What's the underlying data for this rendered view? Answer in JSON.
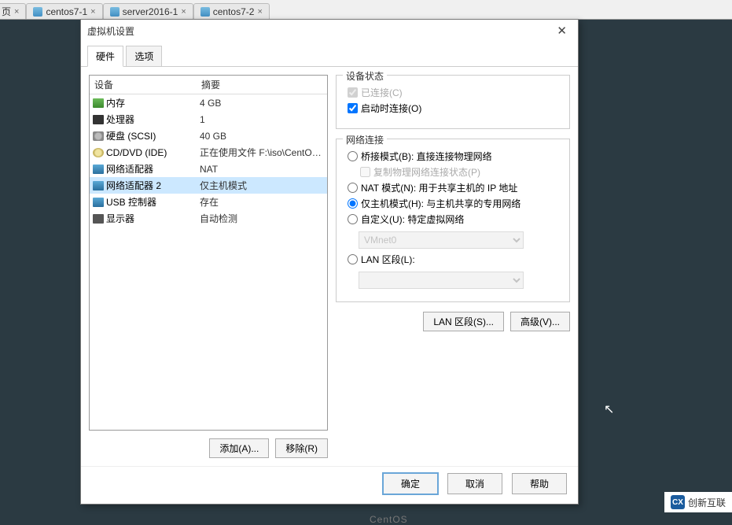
{
  "tabs": {
    "partial": "页",
    "items": [
      {
        "label": "centos7-1"
      },
      {
        "label": "server2016-1"
      },
      {
        "label": "centos7-2"
      }
    ]
  },
  "dialog": {
    "title": "虚拟机设置",
    "close": "✕",
    "tab_hardware": "硬件",
    "tab_options": "选项"
  },
  "device_list": {
    "header_device": "设备",
    "header_summary": "摘要",
    "rows": [
      {
        "icon": "i-mem",
        "name": "mem",
        "label": "内存",
        "summary": "4 GB"
      },
      {
        "icon": "i-cpu",
        "name": "cpu",
        "label": "处理器",
        "summary": "1"
      },
      {
        "icon": "i-hdd",
        "name": "hdd",
        "label": "硬盘 (SCSI)",
        "summary": "40 GB"
      },
      {
        "icon": "i-dvd",
        "name": "dvd",
        "label": "CD/DVD (IDE)",
        "summary": "正在使用文件 F:\\iso\\CentOS-7-..."
      },
      {
        "icon": "i-net",
        "name": "net1",
        "label": "网络适配器",
        "summary": "NAT"
      },
      {
        "icon": "i-net",
        "name": "net2",
        "label": "网络适配器 2",
        "summary": "仅主机模式",
        "selected": true
      },
      {
        "icon": "i-usb",
        "name": "usb",
        "label": "USB 控制器",
        "summary": "存在"
      },
      {
        "icon": "i-disp",
        "name": "display",
        "label": "显示器",
        "summary": "自动检测"
      }
    ],
    "btn_add": "添加(A)...",
    "btn_remove": "移除(R)"
  },
  "right": {
    "device_state": {
      "legend": "设备状态",
      "connected": "已连接(C)",
      "connect_at_start": "启动时连接(O)"
    },
    "net_conn": {
      "legend": "网络连接",
      "bridge": "桥接模式(B): 直接连接物理网络",
      "replicate": "复制物理网络连接状态(P)",
      "nat": "NAT 模式(N): 用于共享主机的 IP 地址",
      "hostonly": "仅主机模式(H): 与主机共享的专用网络",
      "custom": "自定义(U): 特定虚拟网络",
      "vmnet_value": "VMnet0",
      "lan": "LAN 区段(L):",
      "lan_value": ""
    },
    "btn_lan": "LAN 区段(S)...",
    "btn_adv": "高级(V)..."
  },
  "footer": {
    "ok": "确定",
    "cancel": "取消",
    "help": "帮助"
  },
  "watermark": {
    "icon_text": "CX",
    "label": "创新互联"
  },
  "centos_bg": "CentOS"
}
